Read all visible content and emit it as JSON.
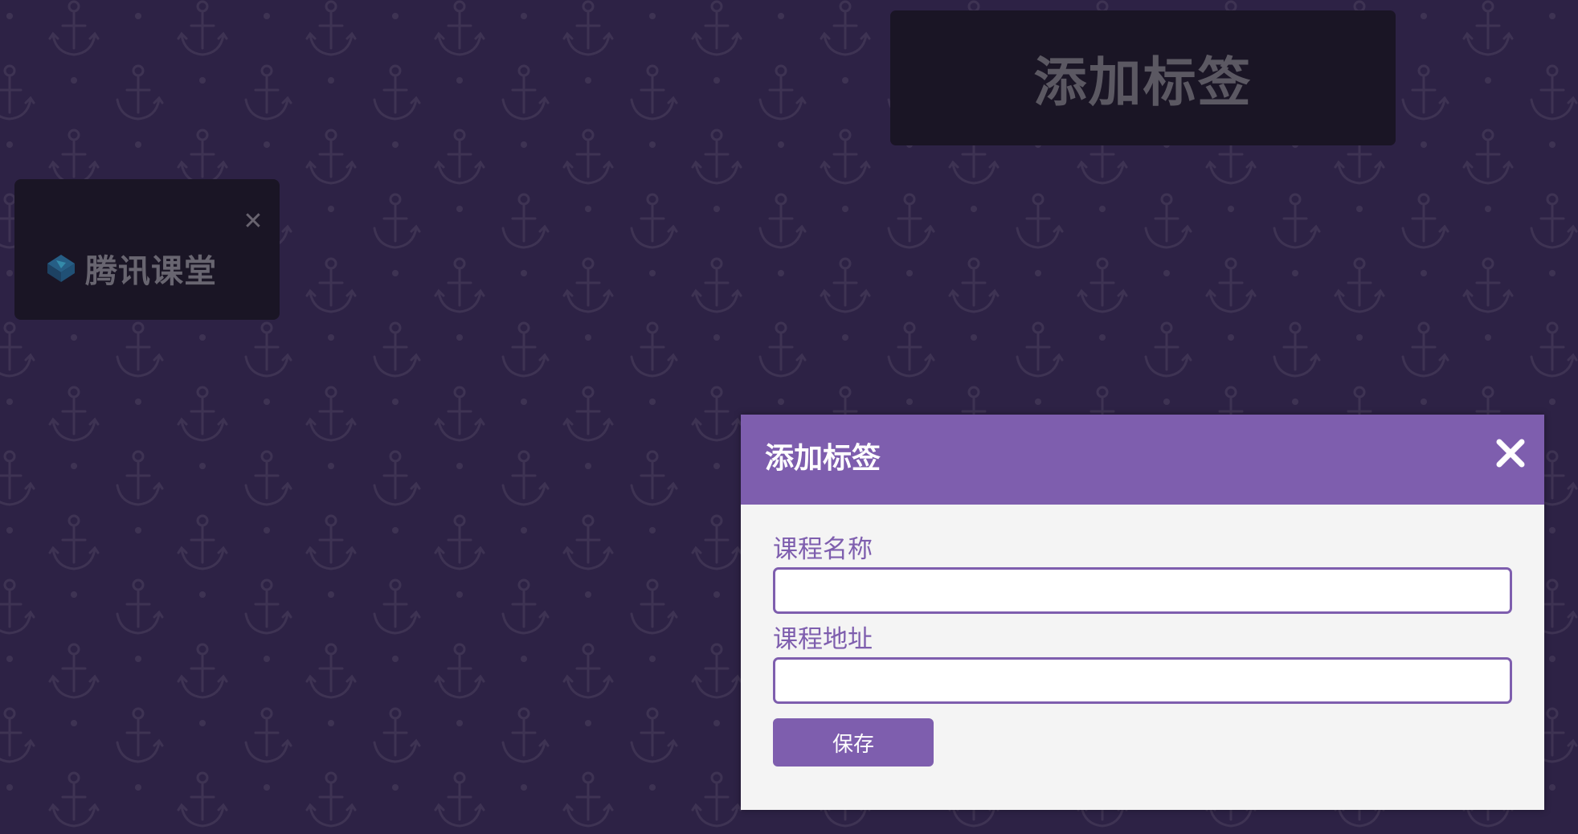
{
  "top_button": {
    "label": "添加标签"
  },
  "tag_card": {
    "label": "腾讯课堂",
    "close_icon": "close-icon",
    "favicon": "tencent-classroom-logo-icon"
  },
  "modal": {
    "title": "添加标签",
    "close_icon": "close-icon",
    "fields": [
      {
        "label": "课程名称",
        "value": "",
        "placeholder": ""
      },
      {
        "label": "课程地址",
        "value": "",
        "placeholder": ""
      }
    ],
    "save_label": "保存"
  },
  "colors": {
    "background": "#33264d",
    "pattern": "#473b5f",
    "accent": "#7e5eae",
    "modal_body": "#f4f4f4",
    "card": "#1c1626"
  },
  "background_icon": "anchor-icon"
}
